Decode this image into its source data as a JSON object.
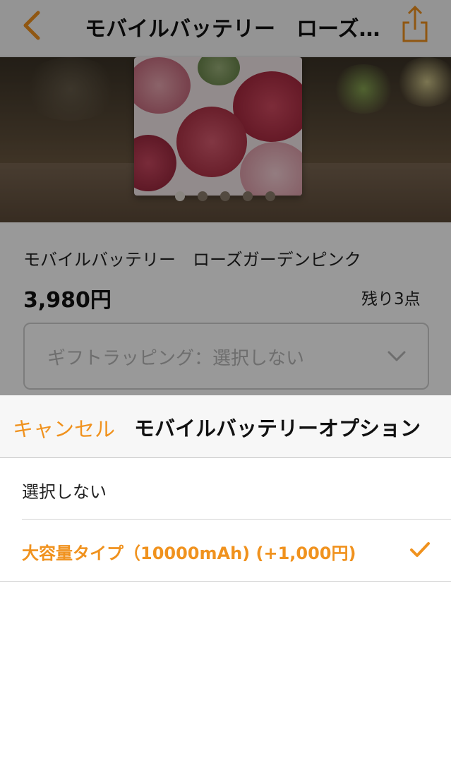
{
  "navbar": {
    "title": "モバイルバッテリー　ローズガーデンピンク",
    "back_icon": "chevron-left-icon",
    "share_icon": "share-icon"
  },
  "product": {
    "name": "モバイルバッテリー　ローズガーデンピンク",
    "price": "3,980円",
    "stock": "残り3点",
    "carousel": {
      "total": 5,
      "active": 1
    },
    "gift_wrapping": {
      "label": "ギフトラッピング：選択しない",
      "icon": "chevron-down-icon"
    }
  },
  "sheet": {
    "cancel_label": "キャンセル",
    "title": "モバイルバッテリーオプション",
    "options": [
      {
        "label": "選択しない",
        "selected": false
      },
      {
        "label": "大容量タイプ（10000mAh) (+1,000円)",
        "selected": true
      }
    ],
    "check_icon": "checkmark-icon"
  },
  "colors": {
    "accent": "#f0921e",
    "text": "#111111",
    "header_bg": "#f7f7f7",
    "overlay": "rgba(0,0,0,0.40)"
  }
}
